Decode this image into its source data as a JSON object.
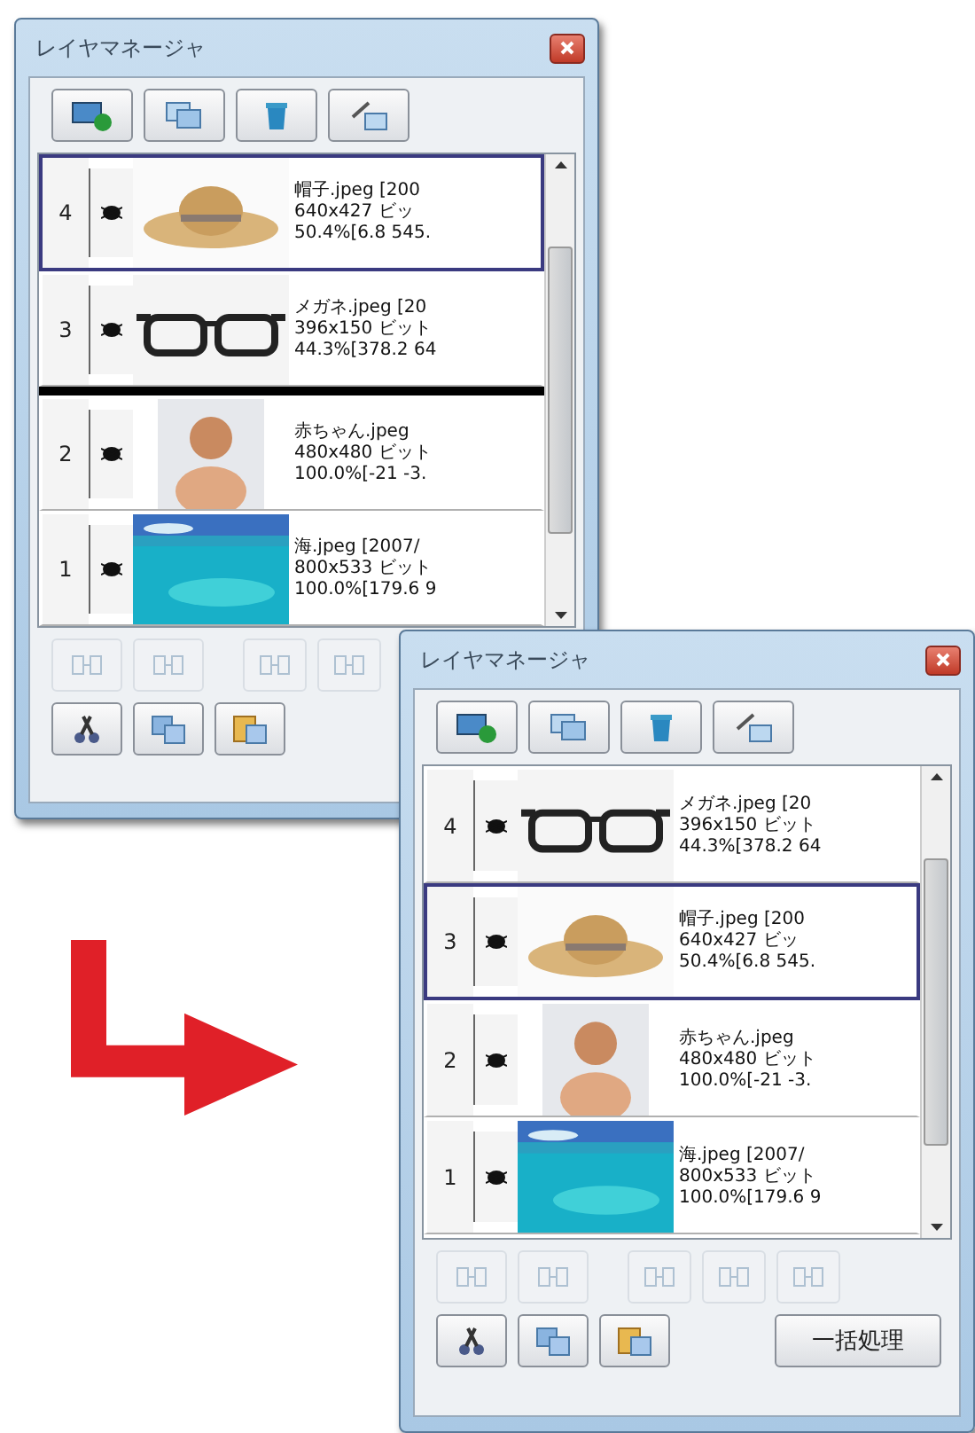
{
  "windows": [
    {
      "title": "レイヤマネージャ",
      "layers": [
        {
          "number": "4",
          "visible": true,
          "selected": true,
          "drop_below": false,
          "kind": "picture",
          "name": "帽子.jpeg [200",
          "size": "640x427 ビッ",
          "info": "50.4%[6.8 545."
        },
        {
          "number": "3",
          "visible": true,
          "selected": false,
          "drop_below": true,
          "kind": "picture",
          "name": "メガネ.jpeg [20",
          "size": "396x150 ビット",
          "info": "44.3%[378.2 64"
        },
        {
          "number": "2",
          "visible": true,
          "selected": false,
          "drop_below": false,
          "kind": "picture",
          "name": "赤ちゃん.jpeg",
          "size": "480x480 ビット",
          "info": "100.0%[-21 -3."
        },
        {
          "number": "1",
          "visible": true,
          "selected": false,
          "drop_below": false,
          "kind": "picture",
          "name": "海.jpeg [2007/",
          "size": "800x533 ビット",
          "info": "100.0%[179.6 9"
        }
      ],
      "edit_tools": [
        {
          "disabled": true
        },
        {
          "disabled": true
        },
        {
          "disabled": true
        },
        {
          "disabled": true
        }
      ],
      "clipboard_tools": [
        {
          "disabled": false
        },
        {
          "disabled": false
        },
        {
          "disabled": false
        }
      ]
    },
    {
      "title": "レイヤマネージャ",
      "layers": [
        {
          "number": "4",
          "visible": true,
          "selected": false,
          "drop_below": false,
          "kind": "picture",
          "name": "メガネ.jpeg [20",
          "size": "396x150 ビット",
          "info": "44.3%[378.2 64"
        },
        {
          "number": "3",
          "visible": true,
          "selected": true,
          "drop_below": false,
          "kind": "picture",
          "name": "帽子.jpeg [200",
          "size": "640x427 ビッ",
          "info": "50.4%[6.8 545."
        },
        {
          "number": "2",
          "visible": true,
          "selected": false,
          "drop_below": false,
          "kind": "picture",
          "name": "赤ちゃん.jpeg",
          "size": "480x480 ビット",
          "info": "100.0%[-21 -3."
        },
        {
          "number": "1",
          "visible": true,
          "selected": false,
          "drop_below": false,
          "kind": "picture",
          "name": "海.jpeg [2007/",
          "size": "800x533 ビット",
          "info": "100.0%[179.6 9"
        }
      ],
      "edit_tools": [
        {
          "disabled": true
        },
        {
          "disabled": true
        },
        {
          "disabled": true
        },
        {
          "disabled": true
        },
        {
          "disabled": true
        }
      ],
      "clipboard_tools": [
        {
          "disabled": false
        },
        {
          "disabled": false
        },
        {
          "disabled": false
        }
      ],
      "batch_button": "一括処理"
    }
  ]
}
